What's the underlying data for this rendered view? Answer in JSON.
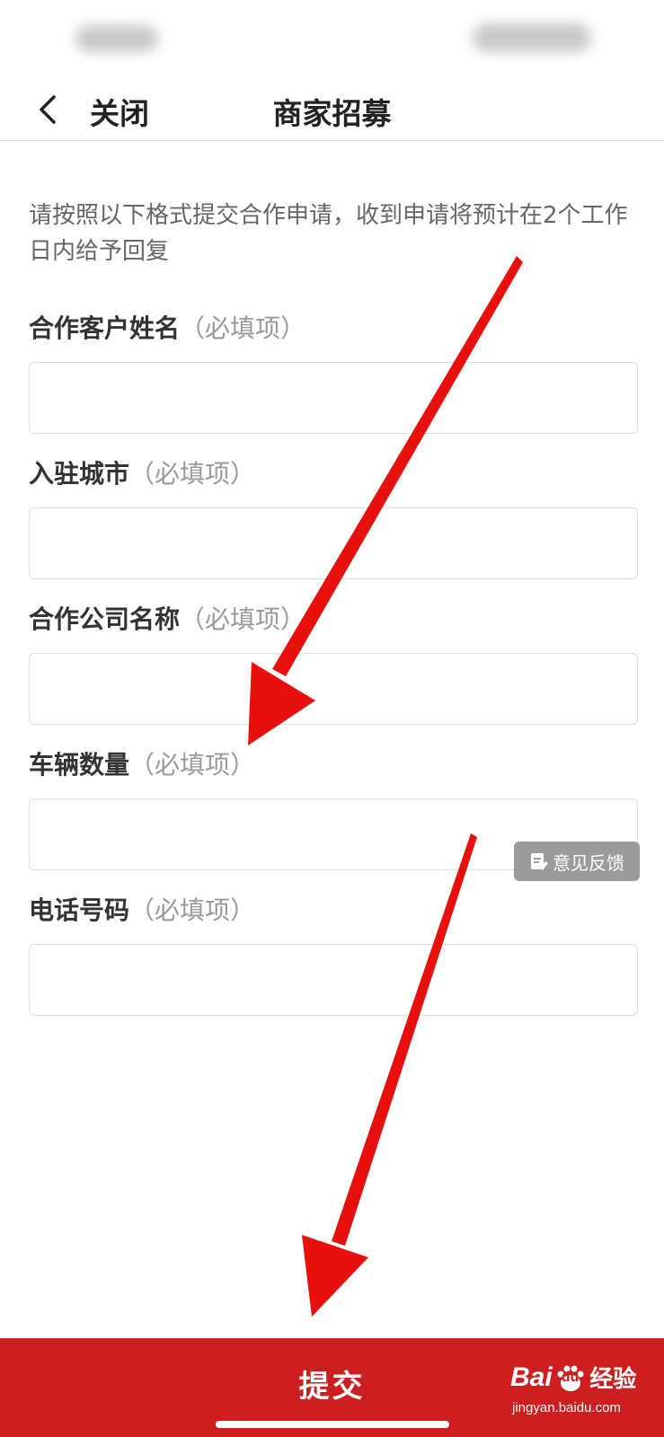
{
  "nav": {
    "close_label": "关闭",
    "title": "商家招募"
  },
  "intro_text": "请按照以下格式提交合作申请，收到申请将预计在2个工作日内给予回复",
  "required_hint": "（必填项）",
  "fields": [
    {
      "label": "合作客户姓名",
      "value": ""
    },
    {
      "label": "入驻城市",
      "value": ""
    },
    {
      "label": "合作公司名称",
      "value": ""
    },
    {
      "label": "车辆数量",
      "value": ""
    },
    {
      "label": "电话号码",
      "value": ""
    }
  ],
  "feedback_label": "意见反馈",
  "submit_label": "提交",
  "watermark": {
    "brand": "Bai",
    "brand_du": "du",
    "suffix": "经验",
    "url": "jingyan.baidu.com"
  },
  "colors": {
    "primary_red": "#cd1f1f",
    "annotation_arrow": "#e8100c",
    "hint_gray": "#999999"
  },
  "icons": {
    "back": "chevron-left-icon",
    "feedback": "edit-note-icon",
    "brand": "baidu-paw-icon"
  }
}
